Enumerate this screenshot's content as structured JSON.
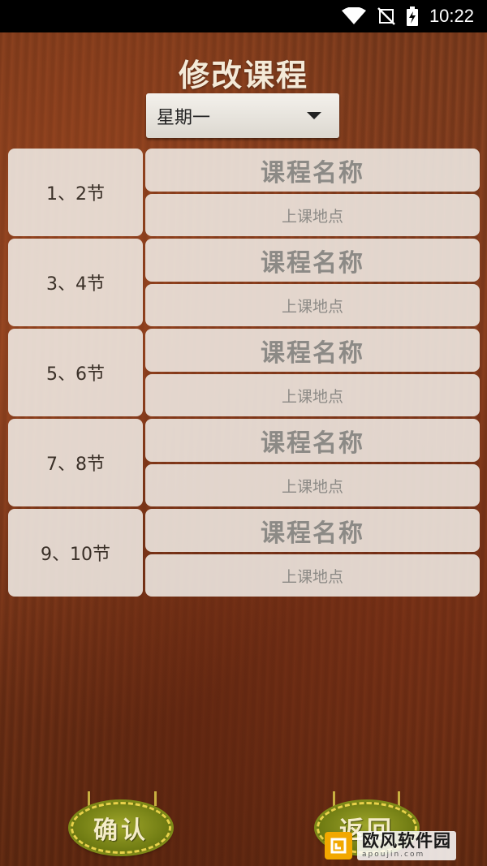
{
  "status_bar": {
    "time": "10:22",
    "icons": [
      "wifi-icon",
      "no-signal-icon",
      "battery-charging-icon"
    ]
  },
  "page": {
    "title": "修改课程"
  },
  "day_select": {
    "value": "星期一"
  },
  "rows": [
    {
      "period": "1、2节",
      "course_placeholder": "课程名称",
      "place_placeholder": "上课地点"
    },
    {
      "period": "3、4节",
      "course_placeholder": "课程名称",
      "place_placeholder": "上课地点"
    },
    {
      "period": "5、6节",
      "course_placeholder": "课程名称",
      "place_placeholder": "上课地点"
    },
    {
      "period": "7、8节",
      "course_placeholder": "课程名称",
      "place_placeholder": "上课地点"
    },
    {
      "period": "9、10节",
      "course_placeholder": "课程名称",
      "place_placeholder": "上课地点"
    }
  ],
  "buttons": {
    "confirm": "确认",
    "back": "返回"
  },
  "watermark": {
    "name": "欧风软件园",
    "url": "apoujin.com"
  },
  "colors": {
    "wood_bg": "#7a3a1c",
    "button_green": "#6e7a12",
    "button_stitch": "#e8d24a",
    "watermark_logo": "#f2a800"
  }
}
